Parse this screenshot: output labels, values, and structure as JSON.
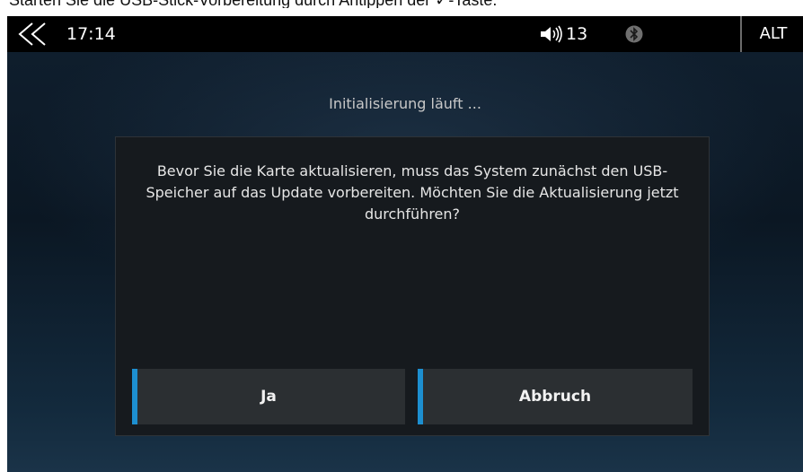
{
  "caption": "Starten Sie die USB-Stick-Vorbereitung durch Antippen der ✓-Taste.",
  "statusbar": {
    "back_icon": "double-chevron-left-icon",
    "time": "17:14",
    "speaker_icon": "speaker-volume-icon",
    "volume": "13",
    "bluetooth_icon": "bluetooth-icon",
    "alt_label": "ALT"
  },
  "screen": {
    "status_text": "Initialisierung läuft ...",
    "dialog": {
      "message": "Bevor Sie die Karte aktualisieren, muss das System zunächst den USB-Speicher auf das Update vorbereiten. Möchten Sie die Aktualisierung jetzt durchführen?",
      "yes_label": "Ja",
      "cancel_label": "Abbruch"
    }
  },
  "colors": {
    "accent": "#1d8fd0",
    "button_bg": "#2b2f32",
    "dialog_bg": "#161a1e",
    "statusbar_bg": "#000000"
  }
}
